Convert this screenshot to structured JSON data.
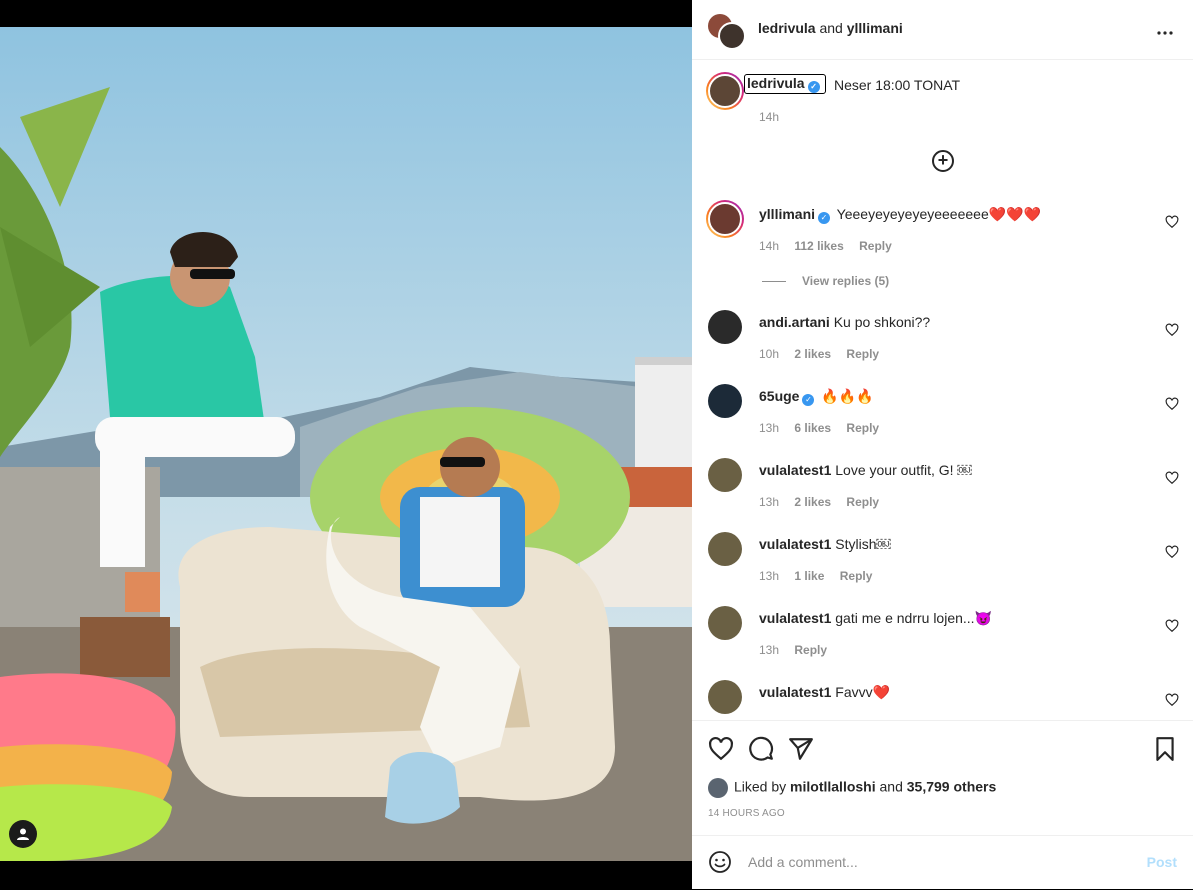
{
  "post": {
    "header": {
      "user1": "ledrivula",
      "joiner": "and",
      "user2": "ylllimani"
    },
    "caption": {
      "username": "ledrivula",
      "text": "Neser 18:00 TONAT",
      "time": "14h"
    },
    "comments": [
      {
        "username": "ylllimani",
        "verified": true,
        "text": "Yeeeyeyeyeyeyeeeeeee",
        "hearts": "❤️❤️❤️",
        "time": "14h",
        "likes": "112 likes",
        "reply": "Reply"
      },
      {
        "username": "andi.artani",
        "verified": false,
        "text": "Ku po shkoni??",
        "time": "10h",
        "likes": "2 likes",
        "reply": "Reply"
      },
      {
        "username": "65uge",
        "verified": true,
        "text": "🔥🔥🔥",
        "time": "13h",
        "likes": "6 likes",
        "reply": "Reply"
      },
      {
        "username": "vulalatest1",
        "verified": false,
        "text": "Love your outfit, G! ￼",
        "time": "13h",
        "likes": "2 likes",
        "reply": "Reply"
      },
      {
        "username": "vulalatest1",
        "verified": false,
        "text": "Stylish￼",
        "time": "13h",
        "likes": "1 like",
        "reply": "Reply"
      },
      {
        "username": "vulalatest1",
        "verified": false,
        "text": "gati me e ndrru lojen...😈",
        "time": "13h",
        "likes": "",
        "reply": "Reply"
      },
      {
        "username": "vulalatest1",
        "verified": false,
        "text": "Favvv❤️",
        "time": "",
        "likes": "",
        "reply": ""
      }
    ],
    "view_replies": "View replies (5)",
    "liked": {
      "prefix": "Liked by",
      "user": "milotllalloshi",
      "joiner": "and",
      "others": "35,799 others"
    },
    "timestamp": "14 HOURS AGO",
    "add_comment": {
      "placeholder": "Add a comment...",
      "post_label": "Post"
    }
  },
  "icons": [
    "more-icon",
    "new-comment-plus-icon",
    "like-icon",
    "comment-icon",
    "share-icon",
    "save-icon",
    "emoji-icon",
    "tag-person-icon",
    "verified-icon",
    "small-heart-icon"
  ]
}
